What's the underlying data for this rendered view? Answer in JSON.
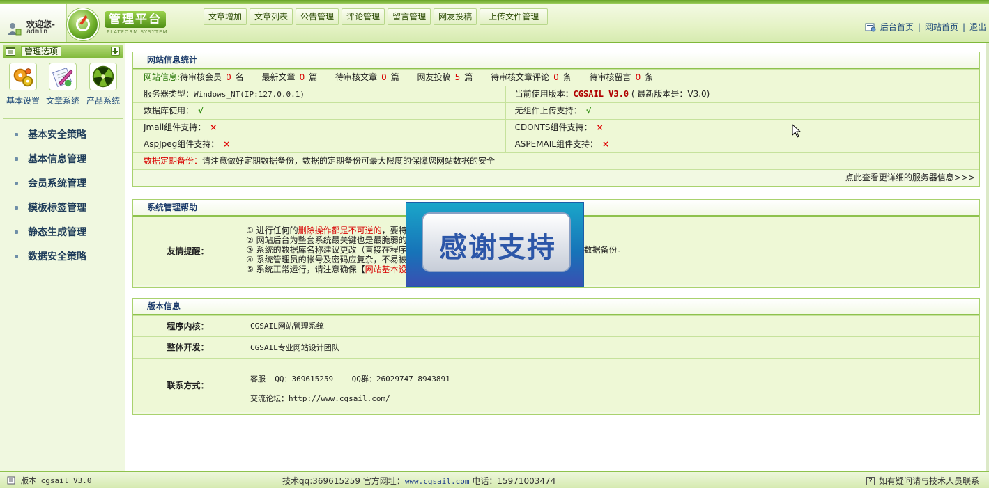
{
  "header": {
    "welcome": "欢迎您-",
    "username": "admin",
    "brand_title": "管理平台",
    "brand_sub": "PLATFORM SYSYTEM",
    "nav": [
      "文章增加",
      "文章列表",
      "公告管理",
      "评论管理",
      "留言管理",
      "网友投稿",
      "上传文件管理"
    ],
    "links": {
      "admin_home": "后台首页",
      "site_home": "网站首页",
      "logout": "退出",
      "sep": "|"
    }
  },
  "sidebar": {
    "head_label": "管理选项",
    "apps": [
      "基本设置",
      "文章系统",
      "产品系统"
    ],
    "menu": [
      "基本安全策略",
      "基本信息管理",
      "会员系统管理",
      "模板标签管理",
      "静态生成管理",
      "数据安全策略"
    ]
  },
  "stats": {
    "title": "网站信息统计",
    "info_label": "网站信息:",
    "pending_members_label": "待审核会员",
    "pending_members": "0",
    "pending_members_unit": "名",
    "latest_articles_label": "最新文章",
    "latest_articles": "0",
    "latest_articles_unit": "篇",
    "pending_articles_label": "待审核文章",
    "pending_articles": "0",
    "pending_articles_unit": "篇",
    "submissions_label": "网友投稿",
    "submissions": "5",
    "submissions_unit": "篇",
    "pending_comments_label": "待审核文章评论",
    "pending_comments": "0",
    "pending_comments_unit": "条",
    "pending_messages_label": "待审核留言",
    "pending_messages": "0",
    "pending_messages_unit": "条",
    "server_type_label": "服务器类型：",
    "server_type": "Windows_NT(IP:127.0.0.1)",
    "current_version_label": "当前使用版本：",
    "current_version": "CGSAIL V3.0",
    "latest_version": "( 最新版本是：V3.0)",
    "db_label": "数据库使用：",
    "db_status": "√",
    "nocomp_upload_label": "无组件上传支持：",
    "nocomp_upload_status": "√",
    "jmail_label": "Jmail组件支持：",
    "jmail_status": "×",
    "cdonts_label": "CDONTS组件支持：",
    "cdonts_status": "×",
    "aspjpeg_label": "AspJpeg组件支持：",
    "aspjpeg_status": "×",
    "aspemail_label": "ASPEMAIL组件支持：",
    "aspemail_status": "×",
    "backup_label": "数据定期备份：",
    "backup_text": "请注意做好定期数据备份，数据的定期备份可最大限度的保障您网站数据的安全",
    "more_link": "点此查看更详细的服务器信息>>>"
  },
  "help": {
    "title": "系统管理帮助",
    "tip_label": "友情提醒：",
    "tip1_prefix": "① 进行任何的",
    "tip1_red": "删除操作都是不可逆的",
    "tip1_suffix": "，要特",
    "tip2": "② 网站后台为整套系统最关键也是最脆弱的",
    "tip3_prefix": "③ 系统的数据库名称建议更改（直接在程序",
    "tip3_suffix": "数据备份。",
    "tip4": "④ 系统管理员的帐号及密码应复杂，不易被",
    "tip5_prefix": "⑤ 系统正常运行，请注意确保【",
    "tip5_red": "网站基本设"
  },
  "version": {
    "title": "版本信息",
    "core_label": "程序内核：",
    "core_value": "CGSAIL网站管理系统",
    "dev_label": "整体开发：",
    "dev_value": "CGSAIL专业网站设计团队",
    "contact_label": "联系方式：",
    "contact_line1": "客服  QQ：369615259    QQ群：26029747 8943891",
    "contact_line2": "交流论坛：http://www.cgsail.com/"
  },
  "ad": {
    "text": "感谢支持"
  },
  "footer": {
    "version_label": "版本 cgsail V3.0",
    "tech_qq": "技术qq:369615259 官方网址：",
    "site_url": "www.cgsail.com",
    "phone": " 电话：15971003474",
    "help_text": "如有疑问请与技术人员联系"
  },
  "colors": {
    "accent": "#7fb83a",
    "panel_bg": "#eef8d6",
    "title_blue": "#1c3b6b",
    "red": "#d80000"
  }
}
